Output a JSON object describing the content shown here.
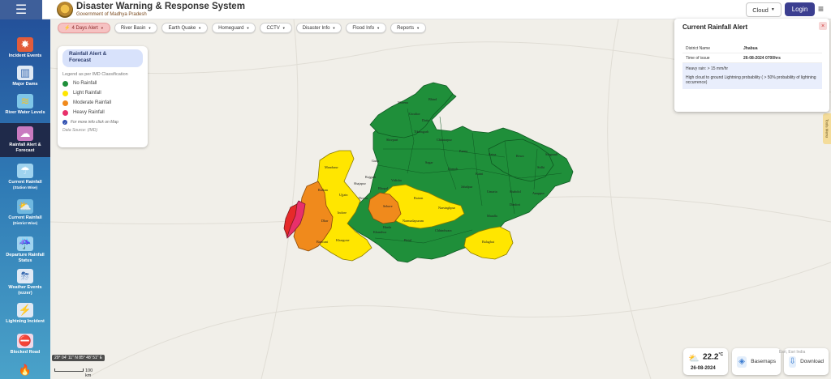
{
  "header": {
    "title": "Disaster Warning & Response System",
    "subtitle": "Government of Madhya Pradesh",
    "cloud_label": "Cloud",
    "login_label": "Login"
  },
  "sidebar": {
    "items": [
      {
        "label": "Incident Events",
        "sub": "",
        "icon": "incident-icon"
      },
      {
        "label": "Major Dams",
        "sub": "",
        "icon": "dam-icon"
      },
      {
        "label": "River Water Levels",
        "sub": "",
        "icon": "water-level-icon"
      },
      {
        "label": "Rainfall Alert &",
        "sub": "Forecast",
        "icon": "rain-cloud-icon",
        "active": true
      },
      {
        "label": "Current Rainfall",
        "sub": "(Station Wise)",
        "icon": "rain-station-icon"
      },
      {
        "label": "Current Rainfall",
        "sub": "(District Wise)",
        "icon": "rain-district-icon"
      },
      {
        "label": "Departure Rainfall",
        "sub": "Status",
        "icon": "departure-icon"
      },
      {
        "label": "Weather Events",
        "sub": "(ezzer)",
        "icon": "weather-icon"
      },
      {
        "label": "Lightning Incident",
        "sub": "",
        "icon": "lightning-icon"
      },
      {
        "label": "Blocked Road",
        "sub": "",
        "icon": "road-icon"
      }
    ]
  },
  "filters": [
    {
      "label": "4 Days Alert",
      "active": true
    },
    {
      "label": "River Basin"
    },
    {
      "label": "Earth Quake"
    },
    {
      "label": "Homeguard"
    },
    {
      "label": "CCTV"
    },
    {
      "label": "Disaster Info"
    },
    {
      "label": "Flood Info"
    },
    {
      "label": "Reports"
    }
  ],
  "legend": {
    "title_line1": "Rainfall Alert &",
    "title_line2": "Forecast",
    "subtitle": "Legend as per IMD Classification",
    "items": [
      {
        "label": "No Rainfall",
        "color": "#1f8f3a"
      },
      {
        "label": "Light Rainfall",
        "color": "#ffe600"
      },
      {
        "label": "Moderate Rainfall",
        "color": "#f08a1c"
      },
      {
        "label": "Heavy Rainfall",
        "color": "#e8306a"
      }
    ],
    "info": "For more info click on Map",
    "source": "Data Source: (IMD)"
  },
  "alert": {
    "title": "Current Rainfall Alert",
    "district_key": "District Name",
    "district_val": "Jhabua",
    "time_key": "Time of issue",
    "time_val": "26-08-2024 0700hrs",
    "line1": "Heavy rain: > 15 mm/hr",
    "line2": "High cloud to ground Lightning probability ( > 50% probability of lightning occurrence)"
  },
  "tools_tab": "Tools Menu",
  "map_labels": [
    {
      "text": "Mandsaur"
    },
    {
      "text": "Ratlam"
    },
    {
      "text": "Ujjain"
    },
    {
      "text": "Dhar"
    },
    {
      "text": "Indore"
    },
    {
      "text": "Barwani"
    },
    {
      "text": "Khargone"
    },
    {
      "text": "Sehore"
    },
    {
      "text": "Raisen"
    },
    {
      "text": "Narsinghpur"
    },
    {
      "text": "Narmadapuram"
    },
    {
      "text": "Chhindwara"
    },
    {
      "text": "Betul"
    },
    {
      "text": "Balaghat"
    },
    {
      "text": "Mandla"
    },
    {
      "text": "Jabalpur"
    },
    {
      "text": "Sagar"
    },
    {
      "text": "Vidisha"
    },
    {
      "text": "Shivpuri"
    },
    {
      "text": "Guna"
    },
    {
      "text": "Satna"
    },
    {
      "text": "Rewa"
    },
    {
      "text": "Sidhi"
    },
    {
      "text": "Shahdol"
    },
    {
      "text": "Umaria"
    },
    {
      "text": "Katni"
    },
    {
      "text": "Damoh"
    },
    {
      "text": "Panna"
    },
    {
      "text": "Chhatarpur"
    },
    {
      "text": "Tikamgarh"
    },
    {
      "text": "Bhopal"
    },
    {
      "text": "Rajgarh"
    },
    {
      "text": "Shajapur"
    },
    {
      "text": "Dewas"
    },
    {
      "text": "Khandwa"
    },
    {
      "text": "Harda"
    },
    {
      "text": "Dindori"
    },
    {
      "text": "Anuppur"
    },
    {
      "text": "Singrauli"
    },
    {
      "text": "Gwalior"
    },
    {
      "text": "Morena"
    },
    {
      "text": "Bhind"
    },
    {
      "text": "Datia"
    }
  ],
  "coords": "29° 04' 11\" N 85° 48' 51\" E",
  "scale": "100 km",
  "weather": {
    "temp": "22.2",
    "unit": "°C",
    "date": "26-08-2024"
  },
  "basemaps_label": "Basemaps",
  "download_label": "Download",
  "attribution": "Esri, Esri India"
}
